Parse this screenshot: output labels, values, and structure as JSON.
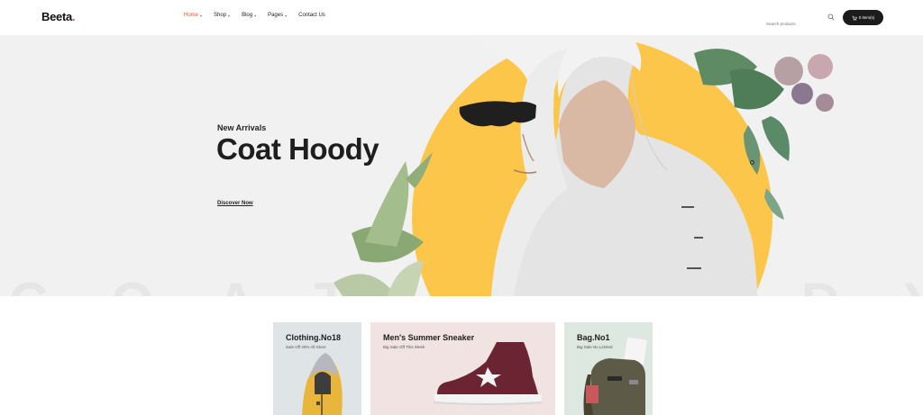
{
  "header": {
    "logo_text": "Beeta",
    "logo_dot": ".",
    "nav": [
      {
        "label": "Home",
        "active": true,
        "dropdown": true
      },
      {
        "label": "Shop",
        "active": false,
        "dropdown": true
      },
      {
        "label": "Blog",
        "active": false,
        "dropdown": true
      },
      {
        "label": "Pages",
        "active": false,
        "dropdown": true
      },
      {
        "label": "Contact Us",
        "active": false,
        "dropdown": false
      }
    ],
    "search_placeholder": "Search products",
    "cart_label": "0 item(s)"
  },
  "hero": {
    "subtitle": "New Arrivals",
    "title": "Coat Hoody",
    "cta": "Discover Now",
    "background_text": "COAT HOODY",
    "accent_color": "#fcc64a"
  },
  "banners": [
    {
      "title": "Clothing.No18",
      "subtitle": "Sale Off 20% All Store"
    },
    {
      "title": "Men's Summer Sneaker",
      "subtitle": "Big Sale Off This Week"
    },
    {
      "title": "Bag.No1",
      "subtitle": "Big Sale No Limited"
    }
  ],
  "colors": {
    "brand_accent": "#e8542a",
    "dark": "#1c1c1c"
  }
}
